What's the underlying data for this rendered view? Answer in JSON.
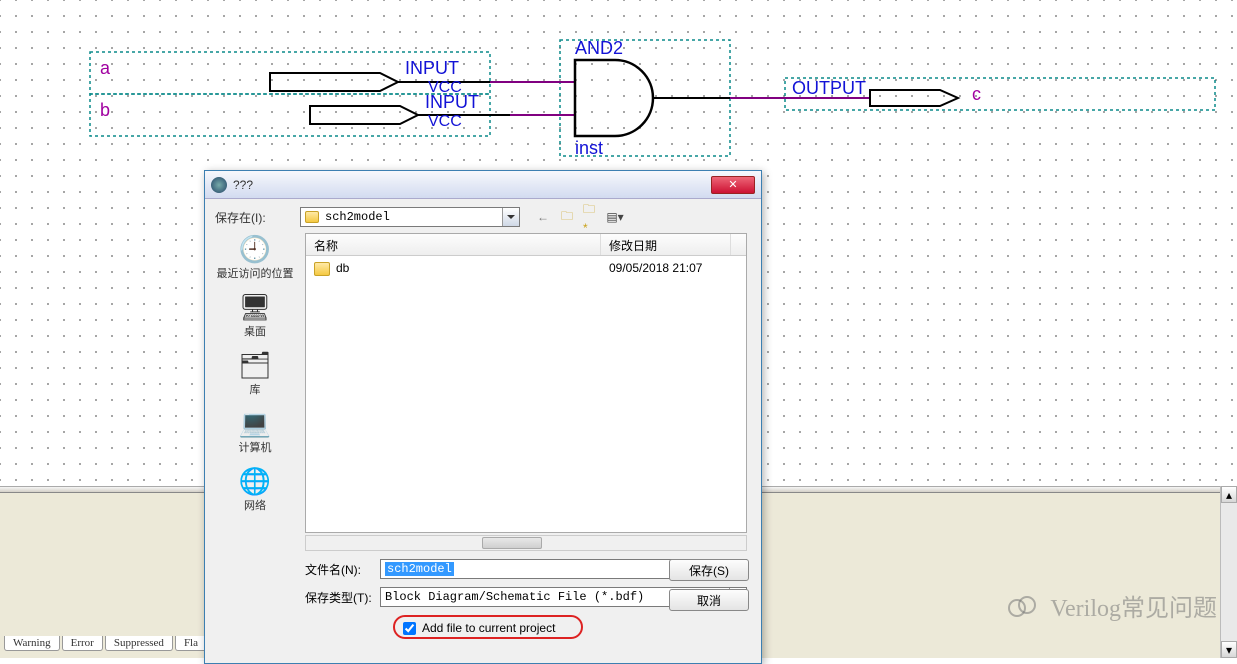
{
  "schematic": {
    "input_a": "a",
    "input_b": "b",
    "output_c": "c",
    "text_input1": "INPUT",
    "text_vcc1": "VCC",
    "text_input2": "INPUT",
    "text_vcc2": "VCC",
    "gate_label": "AND2",
    "inst_label": "inst",
    "text_output": "OUTPUT"
  },
  "dialog": {
    "title": "???",
    "save_in_label": "保存在(I):",
    "save_in_value": "sch2model",
    "places": {
      "recent": "最近访问的位置",
      "desktop": "桌面",
      "libraries": "库",
      "computer": "计算机",
      "network": "网络"
    },
    "columns": {
      "name": "名称",
      "modified": "修改日期"
    },
    "files": [
      {
        "name": "db",
        "modified": "09/05/2018 21:07"
      }
    ],
    "filename_label": "文件名(N):",
    "filename_value": "sch2model",
    "filetype_label": "保存类型(T):",
    "filetype_value": "Block Diagram/Schematic File (*.bdf)",
    "save_btn": "保存(S)",
    "cancel_btn": "取消",
    "add_checkbox": "Add file to current project"
  },
  "tabs": {
    "warning": "Warning",
    "error": "Error",
    "suppressed": "Suppressed",
    "flag": "Fla"
  },
  "watermark": "Verilog常见问题"
}
